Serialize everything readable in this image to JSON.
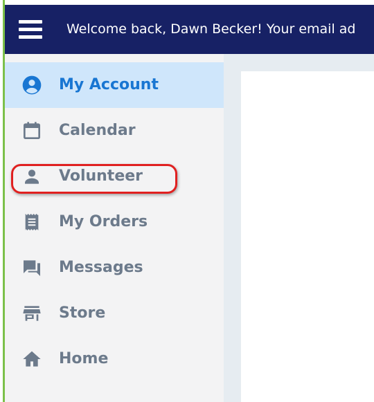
{
  "topbar": {
    "menu_icon": "hamburger-menu-icon",
    "welcome_text": "Welcome back, Dawn Becker! Your email ad"
  },
  "sidebar": {
    "active_color": "#1976d2",
    "items": [
      {
        "label": "My Account",
        "icon": "account-circle-icon",
        "active": true
      },
      {
        "label": "Calendar",
        "icon": "calendar-icon"
      },
      {
        "label": "Volunteer",
        "icon": "person-icon",
        "highlighted": true
      },
      {
        "label": "My Orders",
        "icon": "receipt-icon"
      },
      {
        "label": "Messages",
        "icon": "chat-icon"
      },
      {
        "label": "Store",
        "icon": "store-icon"
      },
      {
        "label": "Home",
        "icon": "home-icon"
      }
    ]
  },
  "colors": {
    "header": "#172165",
    "accent_green": "#7cc04a",
    "highlight_red": "#e02020"
  }
}
